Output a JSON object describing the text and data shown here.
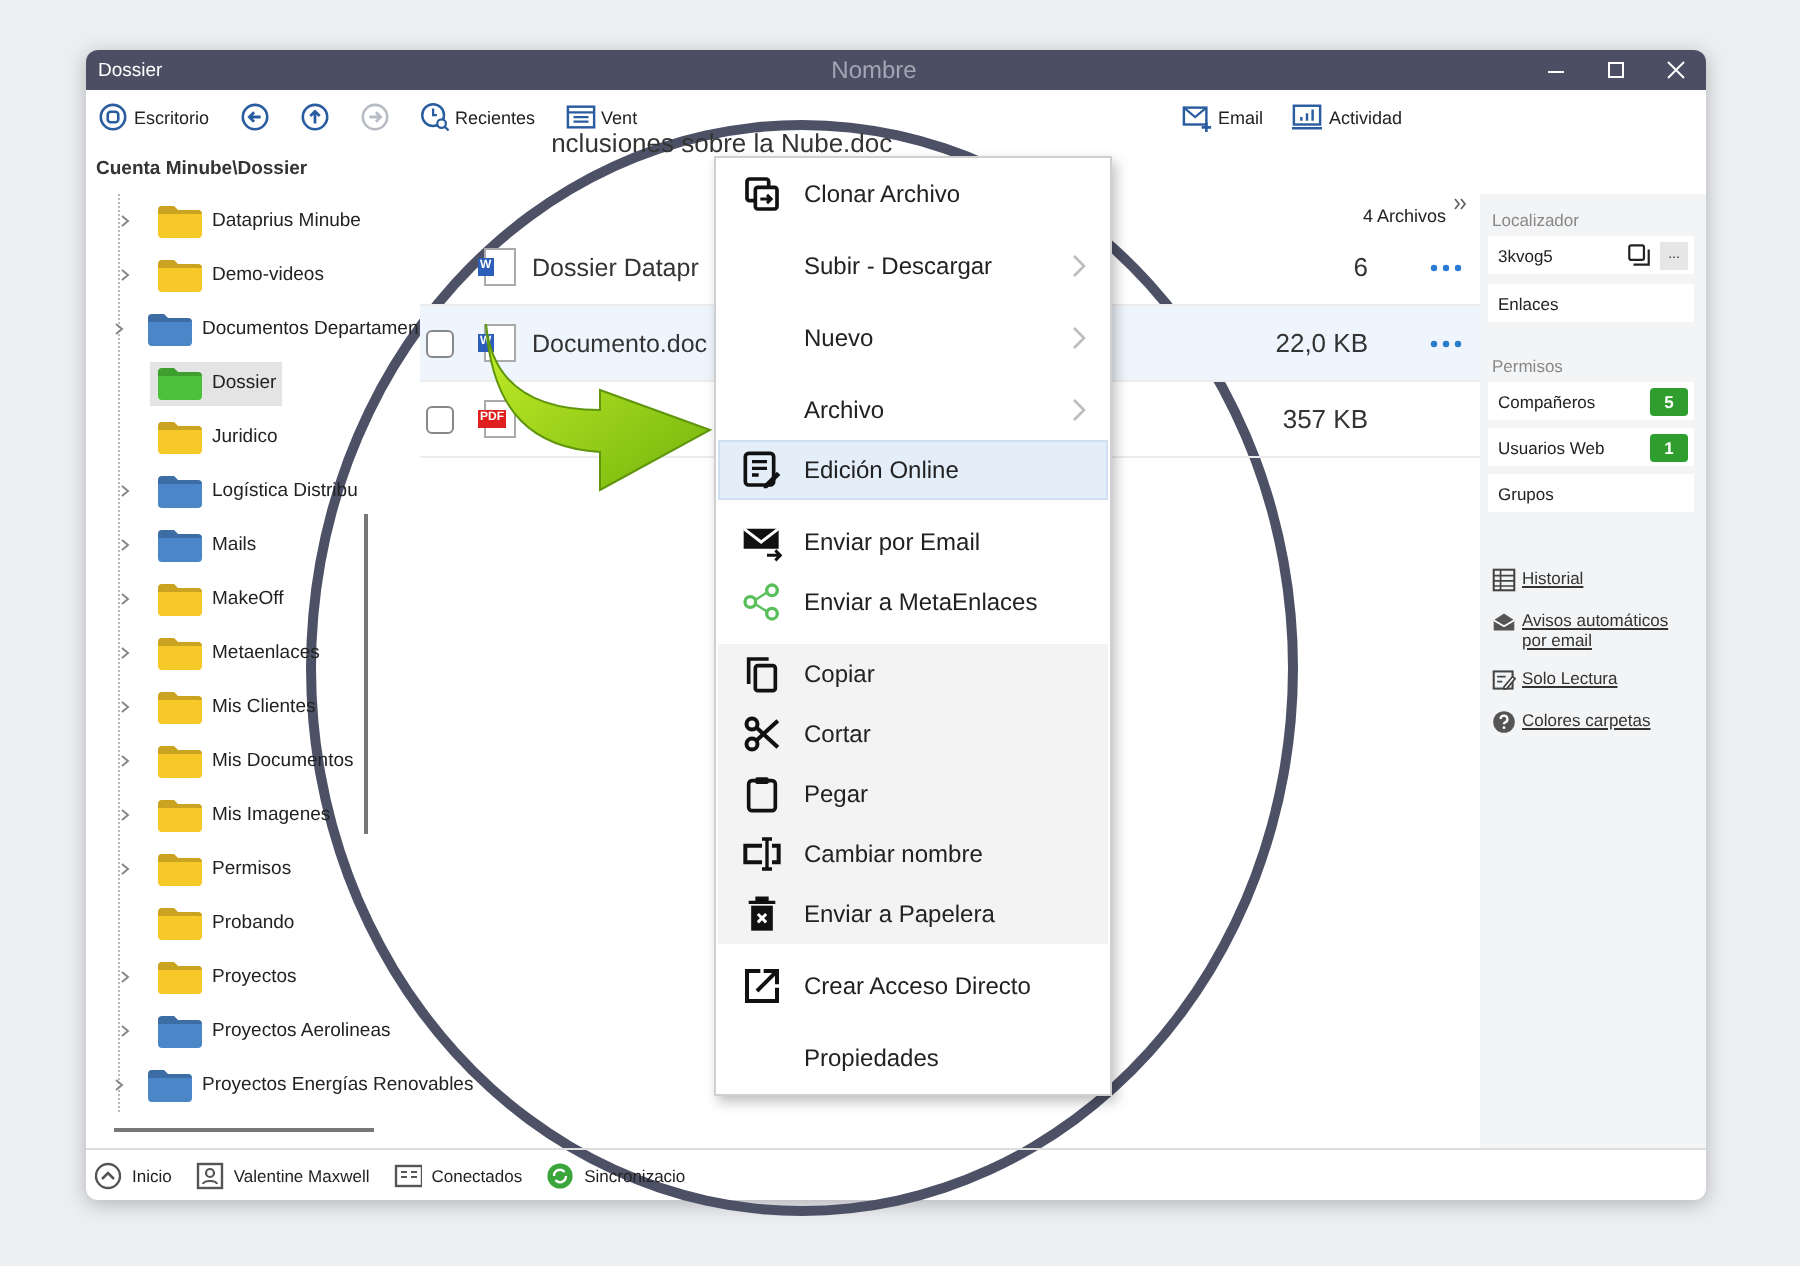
{
  "window": {
    "title": "Dossier",
    "center_title": "Nombre"
  },
  "toolbar": {
    "left": [
      {
        "label": "Escritorio",
        "disabled": false
      },
      {
        "disabled": false
      },
      {
        "disabled": false
      },
      {
        "disabled": true
      },
      {
        "label": "Recientes",
        "disabled": false
      },
      {
        "label": "Vent",
        "disabled": false
      }
    ],
    "right": [
      {
        "label": "Email",
        "disabled": false
      },
      {
        "label": "Actividad",
        "disabled": false
      }
    ]
  },
  "breadcrumb": "Cuenta Minube\\Dossier",
  "current_file": "nclusiones sobre la Nube.doc",
  "tree": {
    "items": [
      {
        "label": "Dataprius Minube",
        "color": "#f7c928",
        "expandable": true,
        "selected": false
      },
      {
        "label": "Demo-videos",
        "color": "#f7c928",
        "expandable": true,
        "selected": false
      },
      {
        "label": "Documentos Departamen",
        "color": "#4a86c8",
        "expandable": true,
        "selected": false
      },
      {
        "label": "Dossier",
        "color": "#4cc23a",
        "expandable": false,
        "selected": true
      },
      {
        "label": "Juridico",
        "color": "#f7c928",
        "expandable": false,
        "selected": false
      },
      {
        "label": "Logística Distribu",
        "color": "#4a86c8",
        "expandable": true,
        "selected": false
      },
      {
        "label": "Mails",
        "color": "#4a86c8",
        "expandable": true,
        "selected": false
      },
      {
        "label": "MakeOff",
        "color": "#f7c928",
        "expandable": true,
        "selected": false
      },
      {
        "label": "Metaenlaces",
        "color": "#f7c928",
        "expandable": true,
        "selected": false
      },
      {
        "label": "Mis Clientes",
        "color": "#f7c928",
        "expandable": true,
        "selected": false
      },
      {
        "label": "Mis Documentos",
        "color": "#f7c928",
        "expandable": true,
        "selected": false
      },
      {
        "label": "Mis Imagenes",
        "color": "#f7c928",
        "expandable": true,
        "selected": false
      },
      {
        "label": "Permisos",
        "color": "#f7c928",
        "expandable": true,
        "selected": false
      },
      {
        "label": "Probando",
        "color": "#f7c928",
        "expandable": false,
        "selected": false
      },
      {
        "label": "Proyectos",
        "color": "#f7c928",
        "expandable": true,
        "selected": false
      },
      {
        "label": "Proyectos Aerolineas",
        "color": "#4a86c8",
        "expandable": true,
        "selected": false
      },
      {
        "label": "Proyectos Energías Renovables",
        "color": "#4a86c8",
        "expandable": true,
        "selected": false
      }
    ]
  },
  "files": {
    "count": "4 Archivos",
    "rows": [
      {
        "name": "Dossier Datapr",
        "kind": "word",
        "type_label": "W",
        "size": "6",
        "actions": true,
        "selected": false
      },
      {
        "name": "Documento.doc",
        "kind": "word",
        "type_label": "W",
        "size": "22,0 KB",
        "actions": true,
        "selected": true,
        "checked": false
      },
      {
        "kind": "pdf",
        "type_label": "PDF",
        "size": "357 KB",
        "actions": false,
        "selected": false,
        "checked": false
      }
    ]
  },
  "context_menu": {
    "items": [
      {
        "kind": "item",
        "label": "Clonar Archivo",
        "submenu": false,
        "selected": false,
        "shaded": false
      },
      {
        "kind": "separator"
      },
      {
        "kind": "item",
        "label": "Subir - Descargar",
        "submenu": true,
        "selected": false,
        "shaded": false
      },
      {
        "kind": "separator"
      },
      {
        "kind": "item",
        "label": "Nuevo",
        "submenu": true,
        "selected": false,
        "shaded": false
      },
      {
        "kind": "separator"
      },
      {
        "kind": "item",
        "label": "Archivo",
        "submenu": true,
        "selected": false,
        "shaded": false
      },
      {
        "kind": "item",
        "label": "Edición Online",
        "submenu": false,
        "selected": true,
        "shaded": false
      },
      {
        "kind": "separator"
      },
      {
        "kind": "item",
        "label": "Enviar por Email",
        "submenu": false,
        "selected": false,
        "shaded": false
      },
      {
        "kind": "item",
        "label": "Enviar a MetaEnlaces",
        "submenu": false,
        "selected": false,
        "shaded": false
      },
      {
        "kind": "separator"
      },
      {
        "kind": "item",
        "label": "Copiar",
        "submenu": false,
        "selected": false,
        "shaded": true
      },
      {
        "kind": "item",
        "label": "Cortar",
        "submenu": false,
        "selected": false,
        "shaded": true
      },
      {
        "kind": "item",
        "label": "Pegar",
        "submenu": false,
        "selected": false,
        "shaded": true
      },
      {
        "kind": "item",
        "label": "Cambiar nombre",
        "submenu": false,
        "selected": false,
        "shaded": true
      },
      {
        "kind": "item",
        "label": "Enviar a Papelera",
        "submenu": false,
        "selected": false,
        "shaded": true
      },
      {
        "kind": "separator"
      },
      {
        "kind": "item",
        "label": "Crear Acceso Directo",
        "submenu": false,
        "selected": false,
        "shaded": false
      },
      {
        "kind": "separator"
      },
      {
        "kind": "item",
        "label": "Propiedades",
        "submenu": false,
        "selected": false,
        "shaded": false
      }
    ]
  },
  "side_panel": {
    "locator_label": "Localizador",
    "locator_value": "3kvog5",
    "more_button": "...",
    "links_box": "Enlaces",
    "permissions_label": "Permisos",
    "permissions": [
      {
        "label": "Compañeros",
        "count": "5"
      },
      {
        "label": "Usuarios Web",
        "count": "1"
      },
      {
        "label": "Grupos"
      }
    ],
    "actions": [
      {
        "label": "Historial"
      },
      {
        "label": "Avisos automáticos por email"
      },
      {
        "label": "Solo Lectura"
      },
      {
        "label": "Colores carpetas"
      }
    ]
  },
  "status_bar": [
    {
      "label": "Inicio"
    },
    {
      "label": "Valentine Maxwell"
    },
    {
      "label": "Conectados"
    },
    {
      "label": "Sincronizacio"
    }
  ]
}
